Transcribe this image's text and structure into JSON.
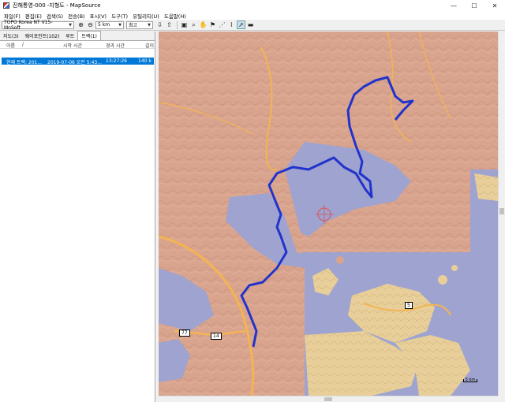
{
  "window": {
    "title": "진해통영-000 -지형도 - MapSource",
    "minimize": "—",
    "maximize": "☐",
    "close": "✕"
  },
  "menu": [
    "파일(F)",
    "편집(E)",
    "검색(S)",
    "전송(B)",
    "표시(V)",
    "도구(T)",
    "유틸리티(U)",
    "도움말(H)"
  ],
  "toolbar": {
    "map_product": "TOPO Korea NT V15-MnSoft",
    "zoom_scale": "5 km",
    "detail": "최고"
  },
  "tabs": [
    {
      "label": "지도(3)",
      "active": false
    },
    {
      "label": "웨이포인트(102)",
      "active": false
    },
    {
      "label": "루트",
      "active": false
    },
    {
      "label": "트랙(1)",
      "active": true
    }
  ],
  "track_list": {
    "headers": {
      "name": "이름",
      "start": "시작 시간",
      "elapsed": "경과 시간",
      "length": "길이"
    },
    "rows": [
      {
        "name": "현재 트랙: 201...",
        "start": "2019-07-06 오전 5:43...",
        "elapsed": "13:27:26",
        "length": "140 k"
      }
    ]
  },
  "map": {
    "road_numbers": [
      "77",
      "14",
      "5"
    ],
    "scale_label": "5 km",
    "colors": {
      "land": "#d9a48e",
      "water": "#9ea3cf",
      "track": "#2233cc",
      "road": "#f3b451"
    }
  }
}
